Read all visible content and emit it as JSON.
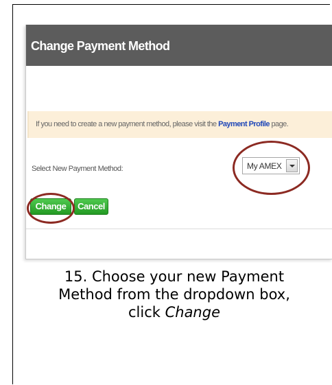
{
  "header": {
    "title": "Change Payment Method"
  },
  "notice": {
    "text_before": "If you need to create a new payment method, please visit the ",
    "link": "Payment Profile",
    "text_after": " page."
  },
  "form": {
    "select_label": "Select New Payment Method:",
    "selected_value": "My AMEX"
  },
  "buttons": {
    "change": "Change",
    "cancel": "Cancel"
  },
  "caption": {
    "line1": "15. Choose your new Payment",
    "line2": "Method from the dropdown box,",
    "line3_prefix": "click ",
    "line3_emphasis": "Change"
  },
  "colors": {
    "header_bg": "#5c5c5c",
    "notice_bg": "#fcefd9",
    "link": "#1f47b8",
    "button_green": "#2fae2f",
    "annotation_ring": "#8c2a22"
  }
}
